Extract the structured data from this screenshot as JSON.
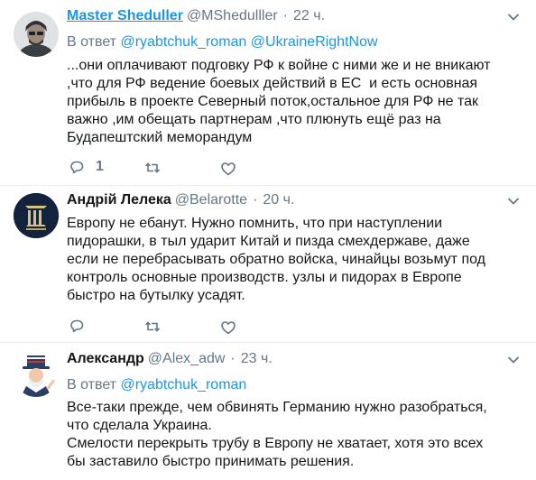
{
  "tweets": [
    {
      "name": "Master Sheduller",
      "handle": "@MShedulller",
      "time": "22 ч.",
      "reply_prefix": "В ответ",
      "mentions": [
        "@ryabtchuk_roman",
        "@UkraineRightNow"
      ],
      "lines": [
        "...они оплачивают подговку РФ к войне с ними же и не вникают",
        ",что для РФ ведение боевых действий в ЕС  и есть основная",
        "прибыль в проекте Северный поток,остальное для РФ не так",
        "важно ,им обещать партнерам ,что плюнуть ещё раз на",
        "Будапештский меморандум"
      ],
      "reply_count": "1"
    },
    {
      "name": "Андрій Лелека",
      "handle": "@Belarotte",
      "time": "20 ч.",
      "lines": [
        "Европу не ебанут. Нужно помнить, что при наступлении",
        "пидорашки, в тыл ударит Китай и пизда смехдержаве, даже",
        "если не перебрасывать обратно войска, чинайцы возьмут под",
        "контроль основные производств. узлы и пидорах в Европе",
        "быстро на бутылку усадят."
      ]
    },
    {
      "name": "Александр",
      "handle": "@Alex_adw",
      "time": "23 ч.",
      "reply_prefix": "В ответ",
      "mentions": [
        "@ryabtchuk_roman"
      ],
      "lines": [
        "Все-таки прежде, чем обвинять Германию нужно разобраться,",
        "что сделала Украина.",
        "Смелости перекрыть трубу в Европу не хватает, хотя это всех",
        "бы заставило быстро принимать решения."
      ]
    }
  ],
  "colors": {
    "accent": "#1b95e0",
    "secondary_text": "#657786",
    "divider": "#e6ecf0"
  },
  "icons": {
    "reply": "reply-icon",
    "retweet": "retweet-icon",
    "like": "heart-icon",
    "caret": "chevron-down-icon"
  }
}
